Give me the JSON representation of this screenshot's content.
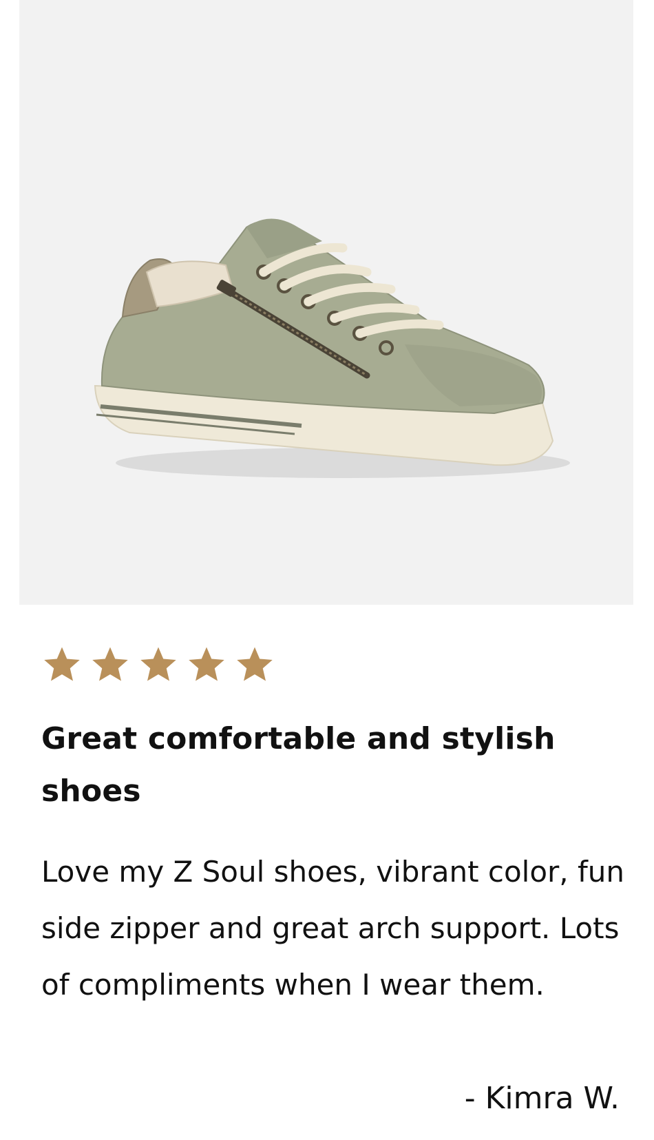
{
  "product": {
    "image_alt": "Sage green low-top sneaker with side zipper and cream laces",
    "image_name": "sneaker-product-image"
  },
  "review": {
    "rating": 5,
    "rating_max": 5,
    "star_color": "#b9905a",
    "title": "Great comfortable and stylish shoes",
    "body": "Love my Z Soul shoes, vibrant color, fun side zipper and great arch support. Lots of compliments when I wear them.",
    "author": "- Kimra W."
  }
}
